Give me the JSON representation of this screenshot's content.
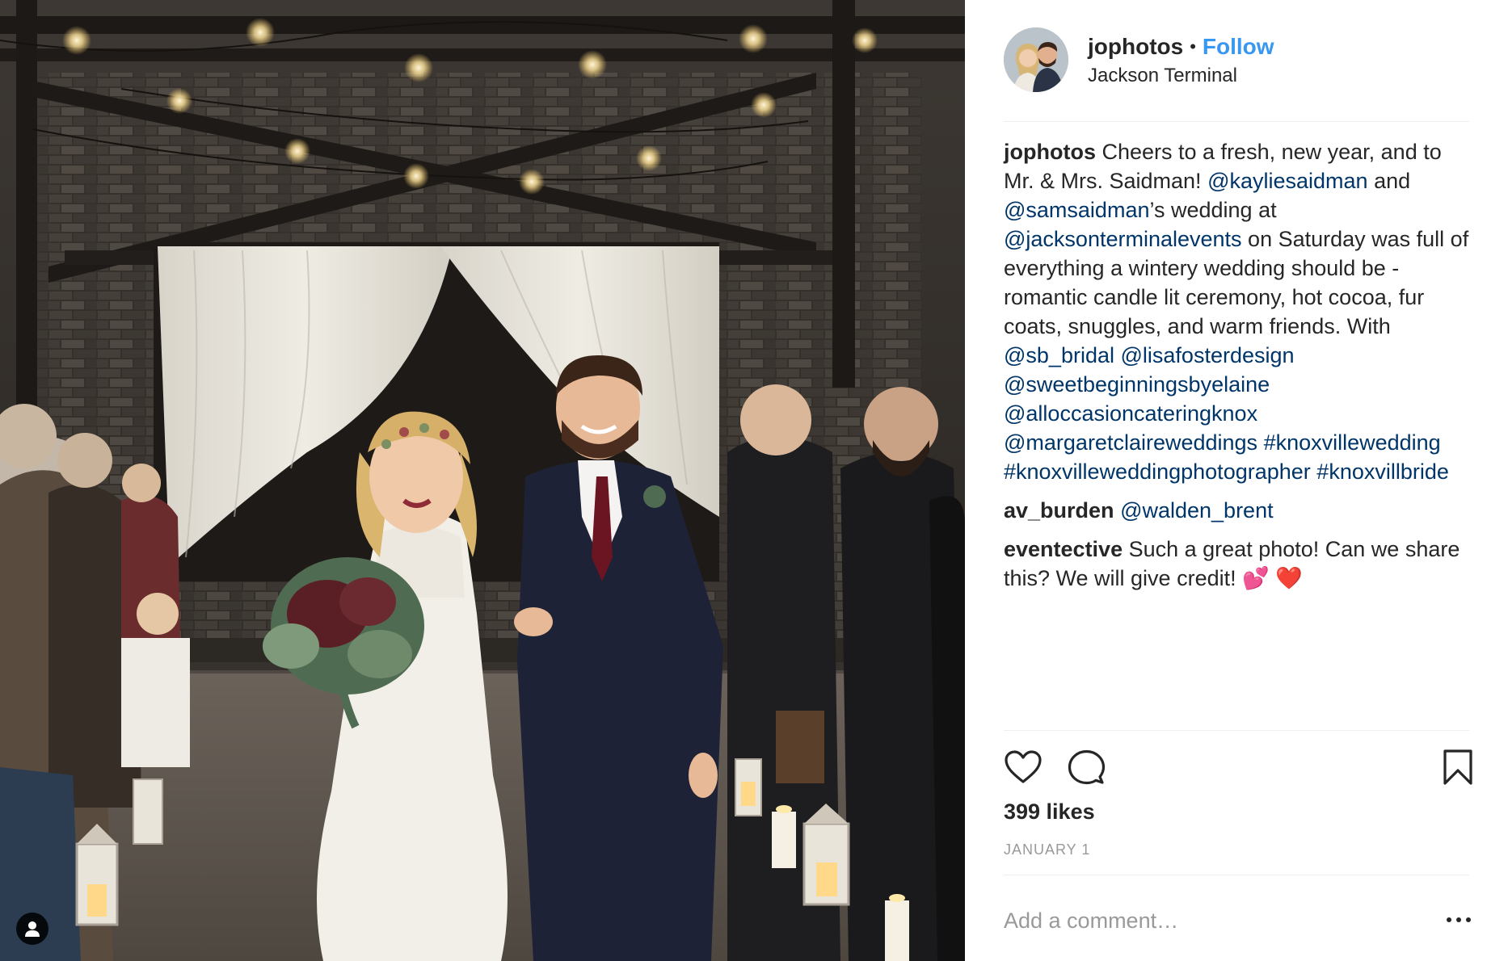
{
  "post": {
    "username": "jophotos",
    "separator": "•",
    "follow_label": "Follow",
    "location": "Jackson Terminal"
  },
  "caption": {
    "user": "jophotos",
    "text_1": " Cheers to a fresh, new year, and to Mr. & Mrs. Saidman! ",
    "tag_1": "@kayliesaidman",
    "text_2": " and ",
    "tag_2": "@samsaidman",
    "text_3": "’s wedding at ",
    "tag_3": "@jacksonterminalevents",
    "text_4": " on Saturday was full of everything a wintery wedding should be - romantic candle lit ceremony, hot cocoa, fur coats, snuggles, and warm friends. With ",
    "tag_4": "@sb_bridal",
    "tag_5": "@lisafosterdesign",
    "tag_6": "@sweetbeginningsbyelaine",
    "tag_7": "@alloccasioncateringknox",
    "tag_8": "@margaretclaireweddings",
    "tag_9": "#knoxvillewedding",
    "tag_10": "#knoxvilleweddingphotographer",
    "tag_11": "#knoxvillbride"
  },
  "comments": [
    {
      "user": "av_burden",
      "mention": "@walden_brent",
      "text": ""
    },
    {
      "user": "eventective",
      "mention": "",
      "text": " Such a great photo! Can we share this? We will give credit! 💕 ❤️"
    }
  ],
  "likes_text": "399 likes",
  "date_text": "JANUARY 1",
  "add_comment_placeholder": "Add a comment…",
  "icons": {
    "like": "heart-icon",
    "comment": "comment-bubble-icon",
    "save": "bookmark-icon",
    "more": "more-options-icon",
    "user_tags": "user-tag-icon"
  },
  "colors": {
    "link_blue": "#3897f0",
    "tag_blue": "#003569",
    "text": "#262626",
    "muted": "#999999",
    "heart_red": "#ed4956"
  }
}
